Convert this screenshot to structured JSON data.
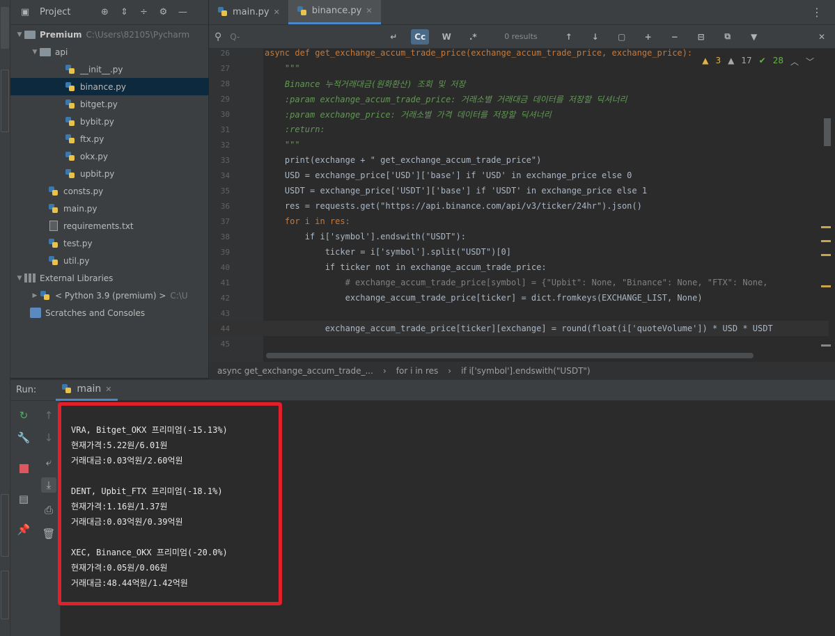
{
  "project": {
    "title": "Project",
    "tree": [
      {
        "label": "Premium",
        "extra": "C:\\Users\\82105\\Pycharm"
      },
      {
        "label": "api"
      },
      {
        "label": "__init__.py"
      },
      {
        "label": "binance.py"
      },
      {
        "label": "bitget.py"
      },
      {
        "label": "bybit.py"
      },
      {
        "label": "ftx.py"
      },
      {
        "label": "okx.py"
      },
      {
        "label": "upbit.py"
      },
      {
        "label": "consts.py"
      },
      {
        "label": "main.py"
      },
      {
        "label": "requirements.txt"
      },
      {
        "label": "test.py"
      },
      {
        "label": "util.py"
      },
      {
        "label": "External Libraries"
      },
      {
        "label": "< Python 3.9 (premium) >",
        "extra": "C:\\U"
      },
      {
        "label": "Scratches and Consoles"
      }
    ]
  },
  "editor": {
    "tabs": [
      {
        "label": "main.py"
      },
      {
        "label": "binance.py"
      }
    ],
    "search": {
      "placeholder": "Q-",
      "results": "0 results",
      "case_label": "Cc",
      "word_label": "W",
      "regex_label": ".*"
    },
    "indicators": {
      "warnings": "3",
      "weak": "17",
      "ok": "28"
    },
    "lines": [
      {
        "n": "26",
        "code": "async def get_exchange_accum_trade_price(exchange_accum_trade_price, exchange_price):"
      },
      {
        "n": "27",
        "code": "    \"\"\""
      },
      {
        "n": "28",
        "code": "    Binance 누적거래대금(원화환산) 조회 및 저장"
      },
      {
        "n": "29",
        "code": "    :param exchange_accum_trade_price: 거래소별 거래대금 데이터를 저장할 딕셔너리"
      },
      {
        "n": "30",
        "code": "    :param exchange_price: 거래소별 가격 데이터를 저장할 딕셔너리"
      },
      {
        "n": "31",
        "code": "    :return:"
      },
      {
        "n": "32",
        "code": "    \"\"\""
      },
      {
        "n": "33",
        "code": "    print(exchange + \" get_exchange_accum_trade_price\")"
      },
      {
        "n": "34",
        "code": "    USD = exchange_price['USD']['base'] if 'USD' in exchange_price else 0"
      },
      {
        "n": "35",
        "code": "    USDT = exchange_price['USDT']['base'] if 'USDT' in exchange_price else 1"
      },
      {
        "n": "36",
        "code": "    res = requests.get(\"https://api.binance.com/api/v3/ticker/24hr\").json()"
      },
      {
        "n": "37",
        "code": "    for i in res:"
      },
      {
        "n": "38",
        "code": "        if i['symbol'].endswith(\"USDT\"):"
      },
      {
        "n": "39",
        "code": "            ticker = i['symbol'].split(\"USDT\")[0]"
      },
      {
        "n": "40",
        "code": "            if ticker not in exchange_accum_trade_price:"
      },
      {
        "n": "41",
        "code": "                # exchange_accum_trade_price[symbol] = {\"Upbit\": None, \"Binance\": None, \"FTX\": None,"
      },
      {
        "n": "42",
        "code": "                exchange_accum_trade_price[ticker] = dict.fromkeys(EXCHANGE_LIST, None)"
      },
      {
        "n": "43",
        "code": ""
      },
      {
        "n": "44",
        "code": "            exchange_accum_trade_price[ticker][exchange] = round(float(i['quoteVolume']) * USD * USDT"
      },
      {
        "n": "45",
        "code": ""
      }
    ],
    "breadcrumb": [
      "async get_exchange_accum_trade_...",
      "for i in res",
      "if i['symbol'].endswith(\"USDT\")"
    ]
  },
  "run": {
    "label": "Run:",
    "tab": "main",
    "output": [
      "VRA, Bitget_OKX 프리미엄(-15.13%)",
      "현재가격:5.22원/6.01원",
      "거래대금:0.03억원/2.60억원",
      "",
      "DENT, Upbit_FTX 프리미엄(-18.1%)",
      "현재가격:1.16원/1.37원",
      "거래대금:0.03억원/0.39억원",
      "",
      "XEC, Binance_OKX 프리미엄(-20.0%)",
      "현재가격:0.05원/0.06원",
      "거래대금:48.44억원/1.42억원"
    ]
  },
  "colors": {
    "highlight_box": "#e0202a",
    "selection": "#0d293e",
    "accent": "#4a88c7"
  }
}
